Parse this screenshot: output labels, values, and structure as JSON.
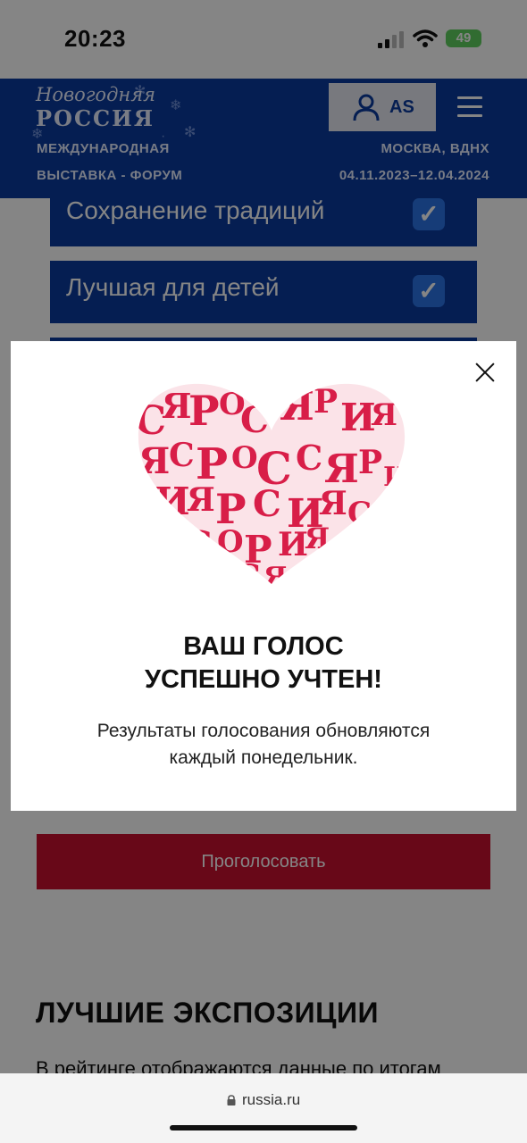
{
  "status_bar": {
    "time": "20:23",
    "battery": "49"
  },
  "header": {
    "logo_line1": "Новогодняя",
    "logo_line2": "РОССИЯ",
    "subtitle_line1": "МЕЖДУНАРОДНАЯ",
    "subtitle_line2": "ВЫСТАВКА - ФОРУМ",
    "location": "МОСКВА, ВДНХ",
    "dates": "04.11.2023–12.04.2024",
    "user_initials": "AS"
  },
  "categories": [
    {
      "label": "Сохранение традиций",
      "checked": true
    },
    {
      "label": "Лучшая для детей",
      "checked": true
    }
  ],
  "vote_button": "Проголосовать",
  "section": {
    "title": "ЛУЧШИЕ ЭКСПОЗИЦИИ",
    "text": "В рейтинге отображаются данные по итогам"
  },
  "modal": {
    "title_line1": "ВАШ ГОЛОС",
    "title_line2": "УСПЕШНО УЧТЕН!",
    "text_line1": "Результаты голосования обновляются",
    "text_line2": "каждый понедельник."
  },
  "browser": {
    "url": "russia.ru"
  },
  "colors": {
    "brand_blue": "#0b3b9e",
    "accent_red": "#c8102e",
    "heart_red": "#d81e48"
  }
}
